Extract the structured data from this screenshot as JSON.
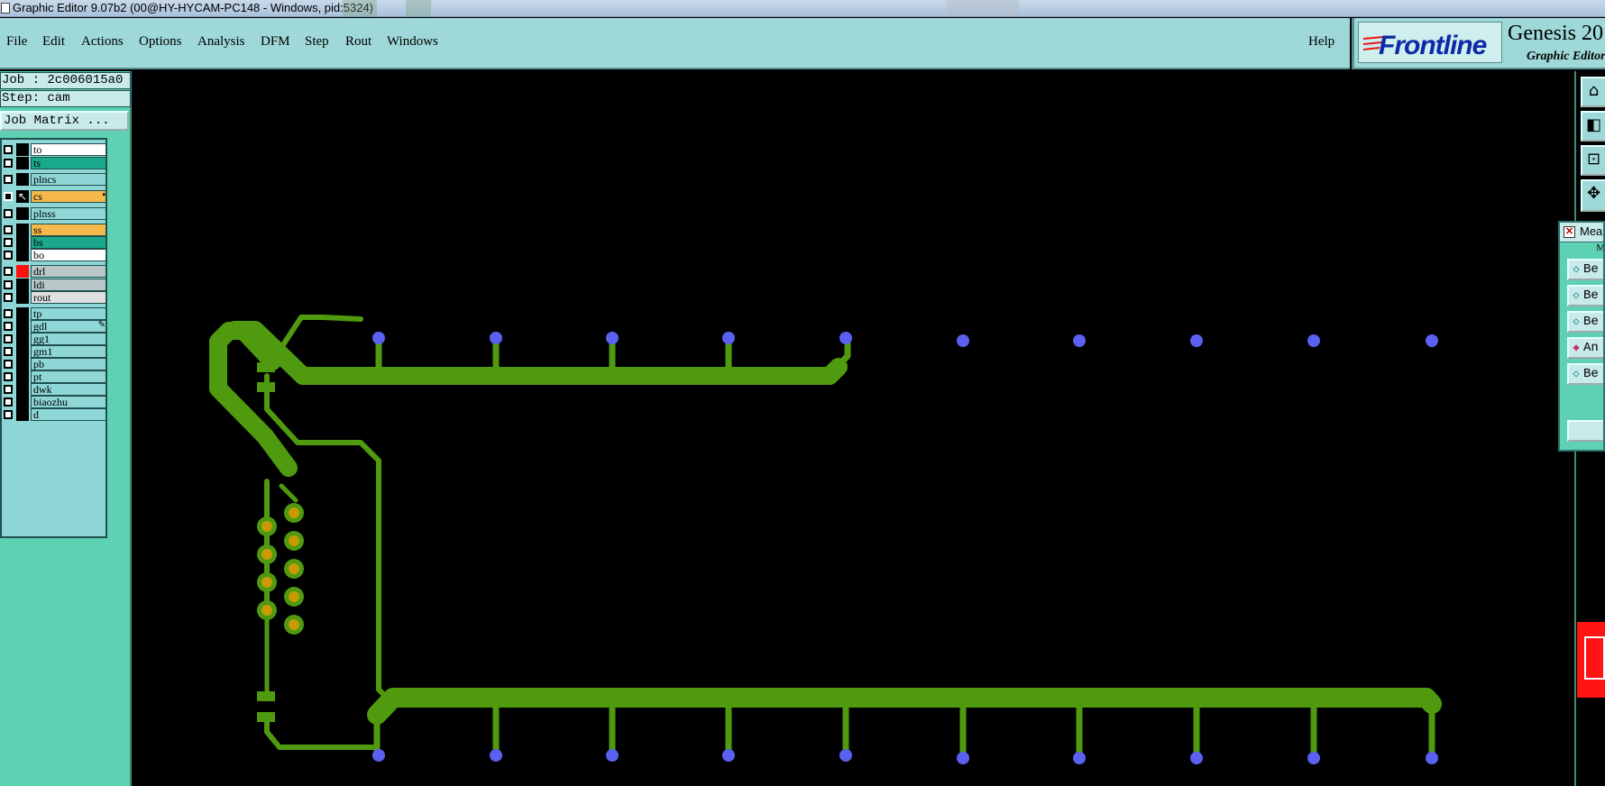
{
  "window": {
    "title": "Graphic Editor 9.07b2 (00@HY-HYCAM-PC148 - Windows, pid:5324)"
  },
  "menu": {
    "file": "File",
    "edit": "Edit",
    "actions": "Actions",
    "options": "Options",
    "analysis": "Analysis",
    "dfm": "DFM",
    "step": "Step",
    "rout": "Rout",
    "windows": "Windows",
    "help": "Help"
  },
  "brand": {
    "logo": "Frontline",
    "product": "Genesis 20",
    "subtitle": "Graphic Editor"
  },
  "job": {
    "job_label": "Job : 2c006015a0",
    "step_label": "Step: cam",
    "matrix_button": "Job Matrix ..."
  },
  "layers": [
    {
      "name": "to",
      "bg": "#ffffff"
    },
    {
      "name": "ts",
      "bg": "#1aa98a"
    },
    {
      "name": "plncs",
      "bg": "#8fd6d6"
    },
    {
      "name": "cs",
      "bg": "#f5b84a"
    },
    {
      "name": "plnss",
      "bg": "#8fd6d6"
    },
    {
      "name": "ss",
      "bg": "#f5b84a"
    },
    {
      "name": "bs",
      "bg": "#1aa98a"
    },
    {
      "name": "bo",
      "bg": "#ffffff"
    },
    {
      "name": "drl",
      "bg": "#b8c8c8"
    },
    {
      "name": "ldi",
      "bg": "#b8c8c8"
    },
    {
      "name": "rout",
      "bg": "#e0e0e0"
    },
    {
      "name": "tp",
      "bg": "#8fd6d6"
    },
    {
      "name": "gdl",
      "bg": "#8fd6d6"
    },
    {
      "name": "gg1",
      "bg": "#8fd6d6"
    },
    {
      "name": "gm1",
      "bg": "#8fd6d6"
    },
    {
      "name": "pb",
      "bg": "#8fd6d6"
    },
    {
      "name": "pt",
      "bg": "#8fd6d6"
    },
    {
      "name": "dwk",
      "bg": "#8fd6d6"
    },
    {
      "name": "biaozhu",
      "bg": "#8fd6d6"
    },
    {
      "name": "d",
      "bg": "#8fd6d6"
    }
  ],
  "measure": {
    "title": "Mea",
    "header": "M",
    "rows": [
      "Be",
      "Be",
      "Be",
      "An",
      "Be"
    ]
  },
  "colors": {
    "trace": "#4f9a0e",
    "via": "#5a60f0",
    "pad": "#c89a08",
    "menu_bg": "#9ed8d8",
    "panel_bg": "#5fd1b3"
  },
  "icons": {
    "right_tools": [
      "zoom-home-icon",
      "zoom-back-icon",
      "zoom-fit-icon",
      "pan-icon"
    ]
  }
}
